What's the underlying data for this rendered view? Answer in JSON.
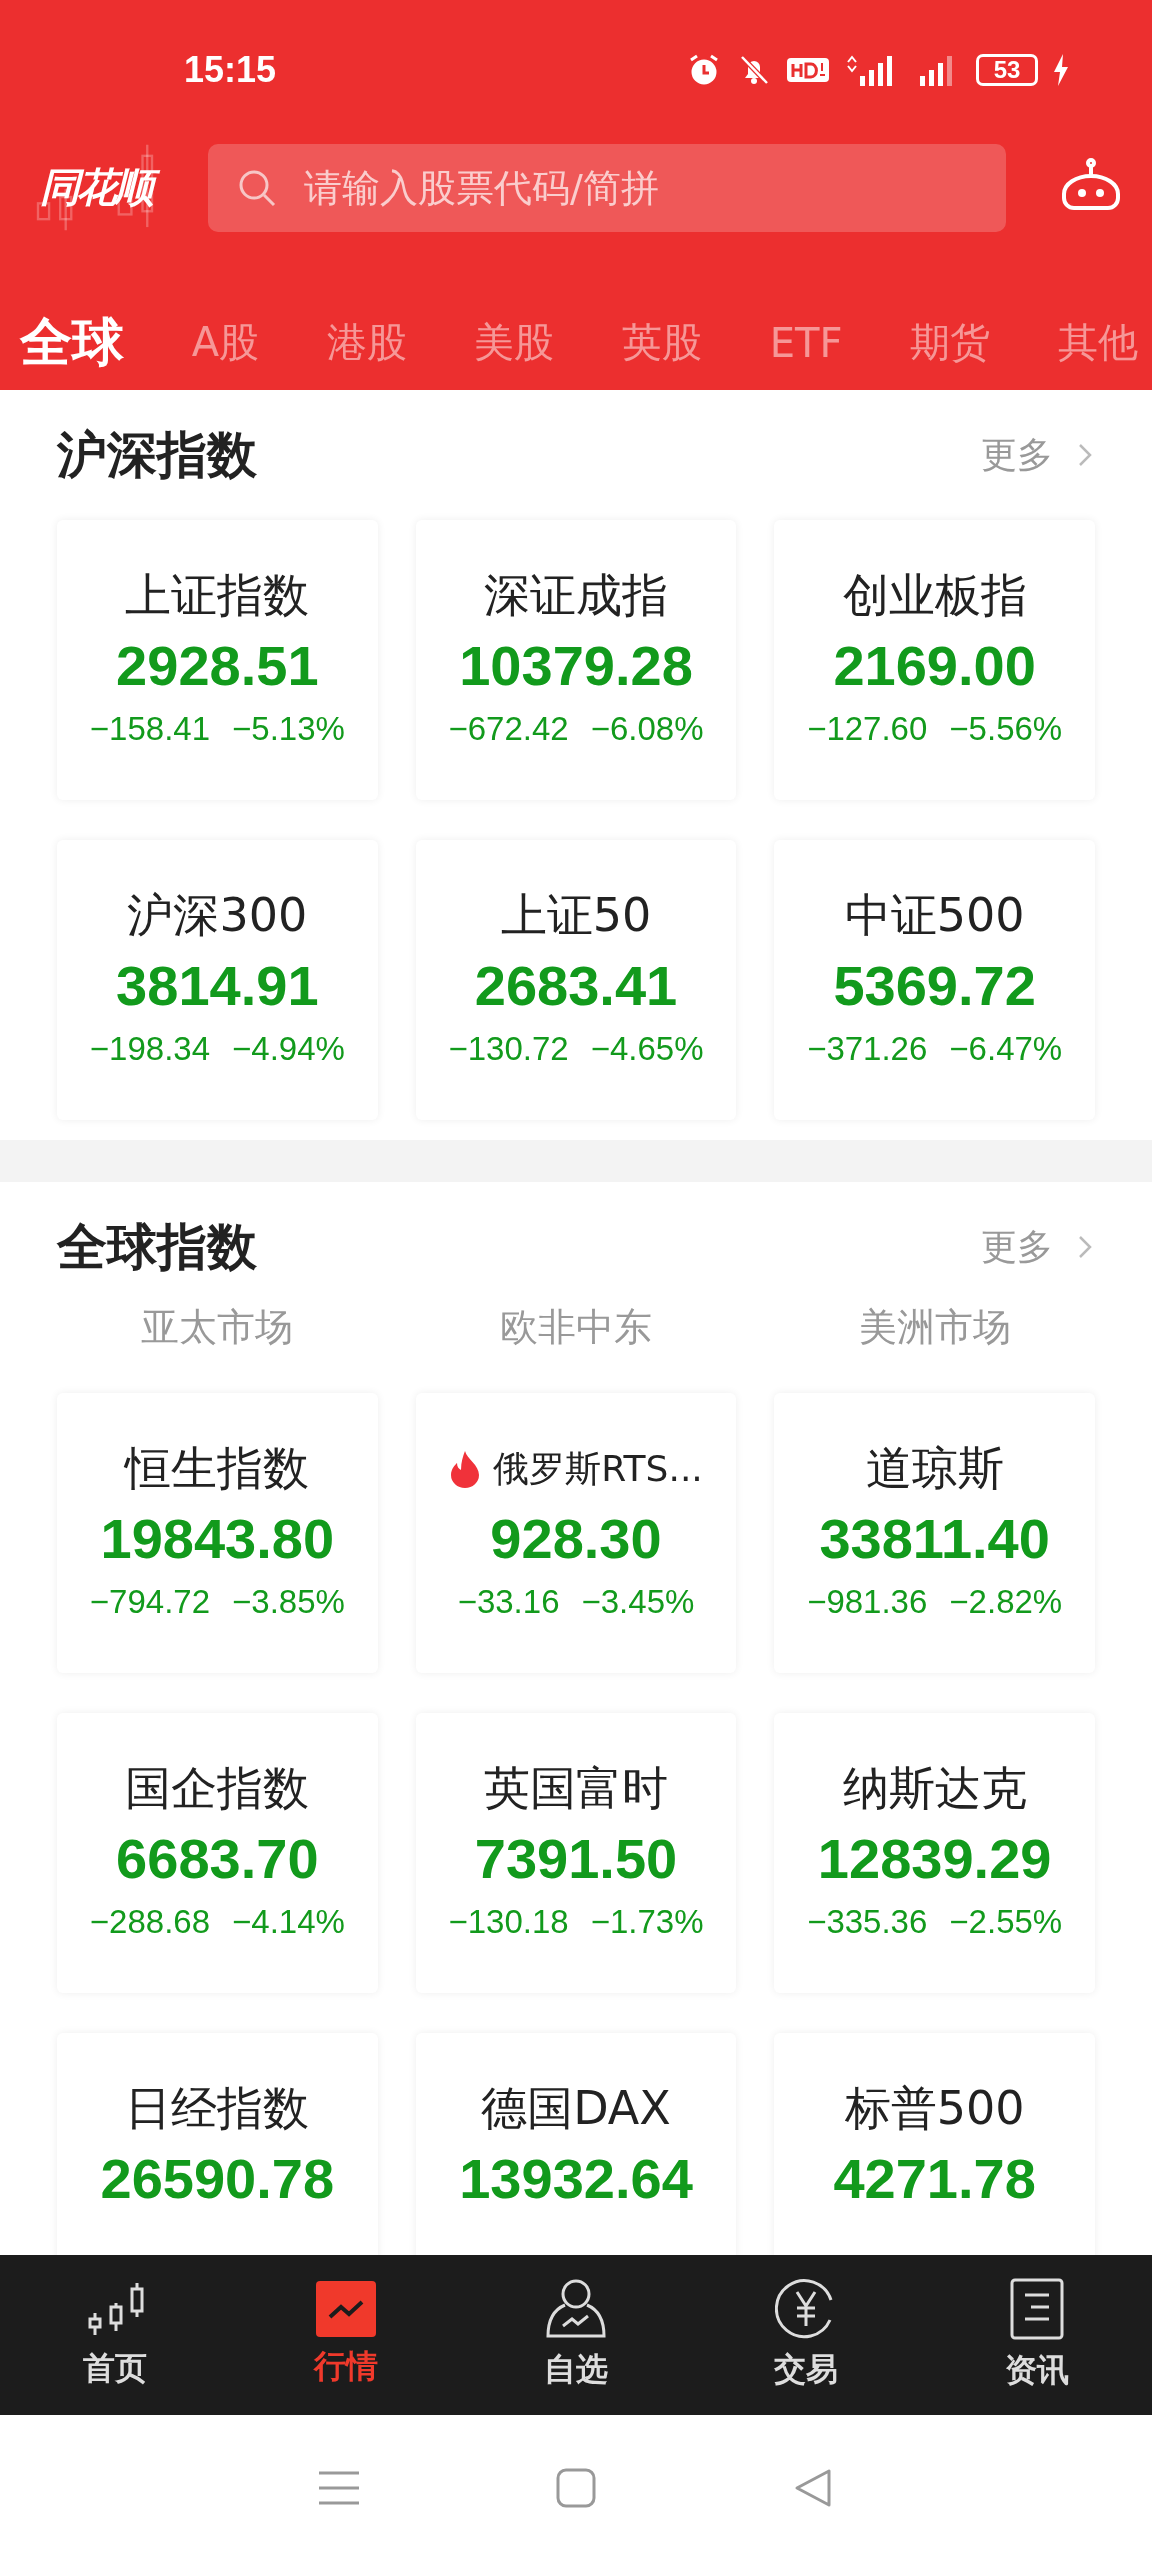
{
  "status_bar": {
    "time": "15:15",
    "battery": "53"
  },
  "header": {
    "logo": "同花顺",
    "search": {
      "placeholder": "请输入股票代码/简拼"
    }
  },
  "tabs": [
    {
      "label": "全球",
      "selected": true
    },
    {
      "label": "A股",
      "selected": false
    },
    {
      "label": "港股",
      "selected": false
    },
    {
      "label": "美股",
      "selected": false
    },
    {
      "label": "英股",
      "selected": false
    },
    {
      "label": "ETF",
      "selected": false
    },
    {
      "label": "期货",
      "selected": false
    },
    {
      "label": "其他",
      "selected": false
    }
  ],
  "sections": [
    {
      "title": "沪深指数",
      "more": "更多",
      "cards": [
        {
          "name": "上证指数",
          "value": "2928.51",
          "change": "−158.41",
          "percent": "−5.13%",
          "hot": false
        },
        {
          "name": "深证成指",
          "value": "10379.28",
          "change": "−672.42",
          "percent": "−6.08%",
          "hot": false
        },
        {
          "name": "创业板指",
          "value": "2169.00",
          "change": "−127.60",
          "percent": "−5.56%",
          "hot": false
        },
        {
          "name": "沪深300",
          "value": "3814.91",
          "change": "−198.34",
          "percent": "−4.94%",
          "hot": false
        },
        {
          "name": "上证50",
          "value": "2683.41",
          "change": "−130.72",
          "percent": "−4.65%",
          "hot": false
        },
        {
          "name": "中证500",
          "value": "5369.72",
          "change": "−371.26",
          "percent": "−6.47%",
          "hot": false
        }
      ]
    },
    {
      "title": "全球指数",
      "more": "更多",
      "regions": [
        "亚太市场",
        "欧非中东",
        "美洲市场"
      ],
      "cards": [
        {
          "name": "恒生指数",
          "value": "19843.80",
          "change": "−794.72",
          "percent": "−3.85%",
          "hot": false
        },
        {
          "name": "俄罗斯RTS...",
          "value": "928.30",
          "change": "−33.16",
          "percent": "−3.45%",
          "hot": true
        },
        {
          "name": "道琼斯",
          "value": "33811.40",
          "change": "−981.36",
          "percent": "−2.82%",
          "hot": false
        },
        {
          "name": "国企指数",
          "value": "6683.70",
          "change": "−288.68",
          "percent": "−4.14%",
          "hot": false
        },
        {
          "name": "英国富时",
          "value": "7391.50",
          "change": "−130.18",
          "percent": "−1.73%",
          "hot": false
        },
        {
          "name": "纳斯达克",
          "value": "12839.29",
          "change": "−335.36",
          "percent": "−2.55%",
          "hot": false
        },
        {
          "name": "日经指数",
          "value": "26590.78",
          "hot": false
        },
        {
          "name": "德国DAX",
          "value": "13932.64",
          "hot": false
        },
        {
          "name": "标普500",
          "value": "4271.78",
          "hot": false
        }
      ]
    }
  ],
  "bottom_nav": [
    {
      "label": "首页",
      "kind": "home",
      "selected": false
    },
    {
      "label": "行情",
      "kind": "market",
      "selected": true
    },
    {
      "label": "自选",
      "kind": "watchlist",
      "selected": false
    },
    {
      "label": "交易",
      "kind": "trade",
      "selected": false
    },
    {
      "label": "资讯",
      "kind": "news",
      "selected": false
    }
  ]
}
